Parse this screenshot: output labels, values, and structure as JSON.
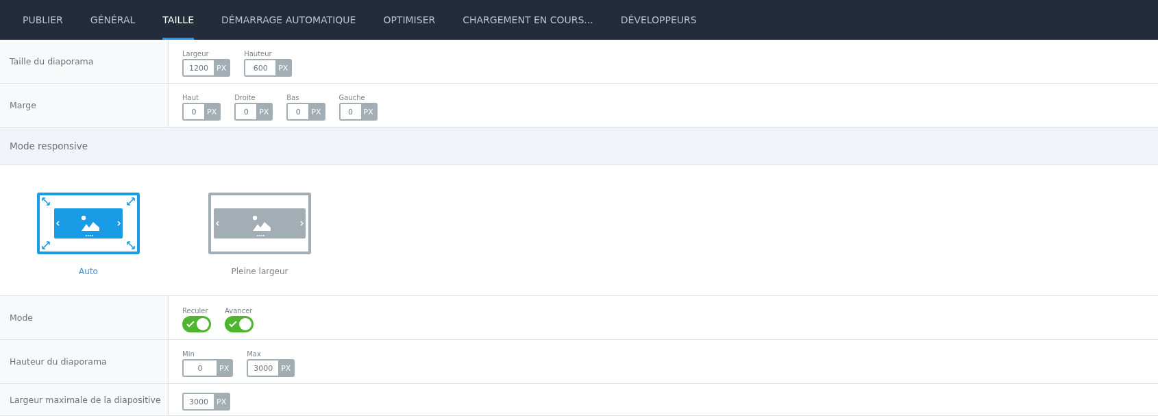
{
  "tabs": [
    {
      "label": "PUBLIER",
      "selected": false
    },
    {
      "label": "GÉNÉRAL",
      "selected": false
    },
    {
      "label": "TAILLE",
      "selected": true
    },
    {
      "label": "DÉMARRAGE AUTOMATIQUE",
      "selected": false
    },
    {
      "label": "OPTIMISER",
      "selected": false
    },
    {
      "label": "CHARGEMENT EN COURS...",
      "selected": false
    },
    {
      "label": "DÉVELOPPEURS",
      "selected": false
    }
  ],
  "blocks": [
    {
      "kind": "fields",
      "label": "Taille du diaporama",
      "fields": [
        {
          "label": "Largeur",
          "value": "1200",
          "unit": "PX"
        },
        {
          "label": "Hauteur",
          "value": "600",
          "unit": "PX"
        }
      ]
    },
    {
      "kind": "fields",
      "label": "Marge",
      "fields": [
        {
          "label": "Haut",
          "value": "0",
          "unit": "PX"
        },
        {
          "label": "Droite",
          "value": "0",
          "unit": "PX"
        },
        {
          "label": "Bas",
          "value": "0",
          "unit": "PX"
        },
        {
          "label": "Gauche",
          "value": "0",
          "unit": "PX"
        }
      ]
    },
    {
      "kind": "header",
      "label": "Mode responsive"
    },
    {
      "kind": "modes",
      "options": [
        {
          "label": "Auto",
          "kind": "auto",
          "selected": true
        },
        {
          "label": "Pleine largeur",
          "kind": "full",
          "selected": false
        }
      ]
    },
    {
      "kind": "toggles",
      "label": "Mode",
      "toggles": [
        {
          "label": "Reculer",
          "on": true
        },
        {
          "label": "Avancer",
          "on": true
        }
      ]
    },
    {
      "kind": "fields",
      "label": "Hauteur du diaporama",
      "fields": [
        {
          "label": "Min",
          "value": "0",
          "unit": "PX"
        },
        {
          "label": "Max",
          "value": "3000",
          "unit": "PX"
        }
      ]
    },
    {
      "kind": "fields",
      "label": "Largeur maximale de la diapositive",
      "fields": [
        {
          "value": "3000",
          "unit": "PX"
        }
      ]
    }
  ]
}
